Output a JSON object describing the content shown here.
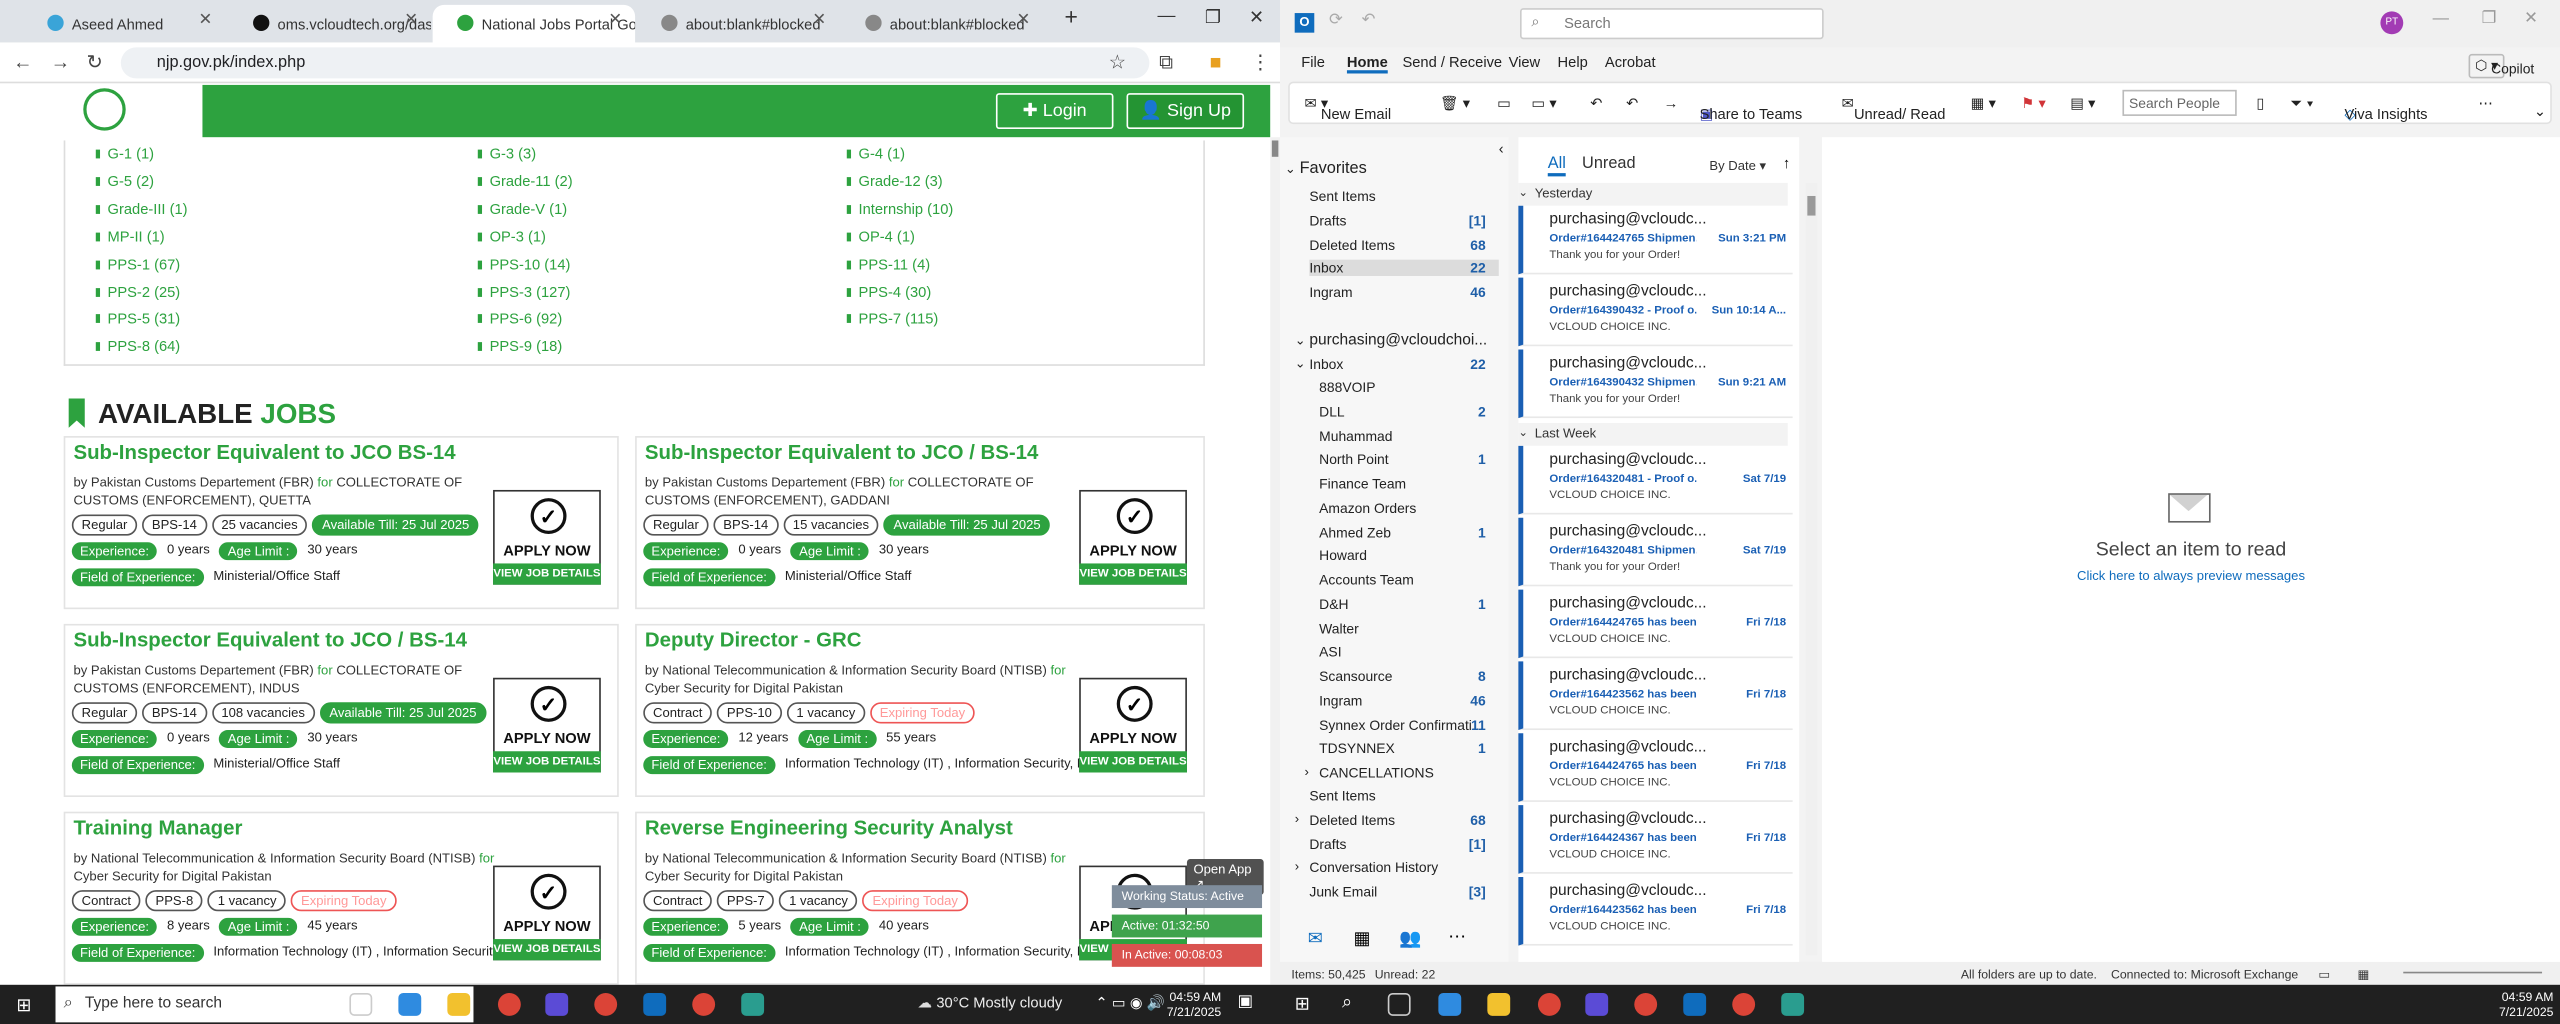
{
  "chrome": {
    "tabs": [
      {
        "label": "Aseed Ahmed"
      },
      {
        "label": "oms.vcloudtech.org/dash"
      },
      {
        "label": "National Jobs Portal Gov"
      },
      {
        "label": "about:blank#blocked"
      },
      {
        "label": "about:blank#blocked"
      }
    ],
    "address": "njp.gov.pk/index.php",
    "login": "Login",
    "signup": "Sign Up"
  },
  "grades": [
    "G-1 (1)",
    "G-3 (3)",
    "G-4 (1)",
    "G-5 (2)",
    "Grade-11 (2)",
    "Grade-12 (3)",
    "Grade-III (1)",
    "Grade-V (1)",
    "Internship (10)",
    "MP-II (1)",
    "OP-3 (1)",
    "OP-4 (1)",
    "PPS-1 (67)",
    "PPS-10 (14)",
    "PPS-11 (4)",
    "PPS-2 (25)",
    "PPS-3 (127)",
    "PPS-4 (30)",
    "PPS-5 (31)",
    "PPS-6 (92)",
    "PPS-7 (115)",
    "PPS-8 (64)",
    "PPS-9 (18)"
  ],
  "section": {
    "title_a": "AVAILABLE",
    "title_b": "JOBS"
  },
  "jobs": [
    {
      "title": "Sub-Inspector Equivalent to JCO BS-14",
      "by": "by",
      "org": "Pakistan Customs Departement (FBR)",
      "for": "for",
      "dept": "COLLECTORATE OF CUSTOMS (ENFORCEMENT), QUETTA",
      "type": "Regular",
      "grade": "BPS-14",
      "vac": "25 vacancies",
      "till": "Available Till: 25 Jul 2025",
      "exp_l": "Experience:",
      "exp": "0 years",
      "age_l": "Age Limit :",
      "age": "30 years",
      "foe_l": "Field of Experience:",
      "foe": "Ministerial/Office Staff",
      "apply": "APPLY NOW",
      "details": "VIEW JOB DETAILS"
    },
    {
      "title": "Sub-Inspector Equivalent to JCO / BS-14",
      "by": "by",
      "org": "Pakistan Customs Departement (FBR)",
      "for": "for",
      "dept": "COLLECTORATE OF CUSTOMS (ENFORCEMENT), GADDANI",
      "type": "Regular",
      "grade": "BPS-14",
      "vac": "15 vacancies",
      "till": "Available Till: 25 Jul 2025",
      "exp_l": "Experience:",
      "exp": "0 years",
      "age_l": "Age Limit :",
      "age": "30 years",
      "foe_l": "Field of Experience:",
      "foe": "Ministerial/Office Staff",
      "apply": "APPLY NOW",
      "details": "VIEW JOB DETAILS"
    },
    {
      "title": "Sub-Inspector Equivalent to JCO / BS-14",
      "by": "by",
      "org": "Pakistan Customs Departement (FBR)",
      "for": "for",
      "dept": "COLLECTORATE OF CUSTOMS (ENFORCEMENT), INDUS",
      "type": "Regular",
      "grade": "BPS-14",
      "vac": "108 vacancies",
      "till": "Available Till: 25 Jul 2025",
      "exp_l": "Experience:",
      "exp": "0 years",
      "age_l": "Age Limit :",
      "age": "30 years",
      "foe_l": "Field of Experience:",
      "foe": "Ministerial/Office Staff",
      "apply": "APPLY NOW",
      "details": "VIEW JOB DETAILS"
    },
    {
      "title": "Deputy Director - GRC",
      "by": "by",
      "org": "National Telecommunication & Information Security Board (NTISB)",
      "for": "for",
      "dept": "Cyber Security for Digital Pakistan",
      "type": "Contract",
      "grade": "PPS-10",
      "vac": "1 vacancy",
      "till": "Expiring Today",
      "exp_l": "Experience:",
      "exp": "12 years",
      "age_l": "Age Limit :",
      "age": "55 years",
      "foe_l": "Field of Experience:",
      "foe": "Information Technology (IT) , Information Security, Project M",
      "apply": "APPLY NOW",
      "details": "VIEW JOB DETAILS"
    },
    {
      "title": "Training Manager",
      "by": "by",
      "org": "National Telecommunication & Information Security Board (NTISB)",
      "for": "for",
      "dept": "Cyber Security for Digital Pakistan",
      "type": "Contract",
      "grade": "PPS-8",
      "vac": "1 vacancy",
      "till": "Expiring Today",
      "exp_l": "Experience:",
      "exp": "8 years",
      "age_l": "Age Limit :",
      "age": "45 years",
      "foe_l": "Field of Experience:",
      "foe": "Information Technology (IT) , Information Security, Projec",
      "apply": "APPLY NOW",
      "details": "VIEW JOB DETAILS"
    },
    {
      "title": "Reverse Engineering Security Analyst",
      "by": "by",
      "org": "National Telecommunication & Information Security Board (NTISB)",
      "for": "for",
      "dept": "Cyber Security for Digital Pakistan",
      "type": "Contract",
      "grade": "PPS-7",
      "vac": "1 vacancy",
      "till": "Expiring Today",
      "exp_l": "Experience:",
      "exp": "5 years",
      "age_l": "Age Limit :",
      "age": "40 years",
      "foe_l": "Field of Experience:",
      "foe": "Information Technology (IT) , Information Security, Project M",
      "apply": "APPLY NOW",
      "details": "VIEW JOB DETAILS"
    }
  ],
  "tracker": {
    "open": "Open App ↗",
    "status": "Working Status: Active",
    "active": "Active: 01:32:50",
    "inactive": "In Active: 00:08:03"
  },
  "outlook": {
    "search": "Search",
    "copilot": "Copilot",
    "avatar": "PT",
    "menu": [
      "File",
      "Home",
      "Send / Receive",
      "View",
      "Help",
      "Acrobat"
    ],
    "ribbon": {
      "new_email": "New Email",
      "share": "Share to Teams",
      "unread": "Unread/ Read",
      "search_people": "Search People",
      "viva": "Viva Insights"
    },
    "favorites_label": "Favorites",
    "favorites": [
      {
        "name": "Sent Items",
        "count": ""
      },
      {
        "name": "Drafts",
        "count": "[1]"
      },
      {
        "name": "Deleted Items",
        "count": "68"
      },
      {
        "name": "Inbox",
        "count": "22"
      },
      {
        "name": "Ingram",
        "count": "46"
      }
    ],
    "account": "purchasing@vcloudchoi...",
    "inbox_label": "Inbox",
    "inbox_count": "22",
    "subfolders": [
      {
        "name": "888VOIP",
        "count": ""
      },
      {
        "name": "DLL",
        "count": "2"
      },
      {
        "name": "Muhammad",
        "count": ""
      },
      {
        "name": "North Point",
        "count": "1"
      },
      {
        "name": "Finance Team",
        "count": ""
      },
      {
        "name": "Amazon Orders",
        "count": ""
      },
      {
        "name": "Ahmed Zeb",
        "count": "1"
      },
      {
        "name": "Howard",
        "count": ""
      },
      {
        "name": "Accounts Team",
        "count": ""
      },
      {
        "name": "D&H",
        "count": "1"
      },
      {
        "name": "Walter",
        "count": ""
      },
      {
        "name": "ASI",
        "count": ""
      },
      {
        "name": "Scansource",
        "count": "8"
      },
      {
        "name": "Ingram",
        "count": "46"
      },
      {
        "name": "Synnex Order Confirmati...",
        "count": "11"
      },
      {
        "name": "TDSYNNEX",
        "count": "1"
      },
      {
        "name": "CANCELLATIONS",
        "count": ""
      }
    ],
    "root_folders": [
      {
        "name": "Sent Items",
        "count": ""
      },
      {
        "name": "Deleted Items",
        "count": "68"
      },
      {
        "name": "Drafts",
        "count": "[1]"
      },
      {
        "name": "Conversation History",
        "count": ""
      },
      {
        "name": "Junk Email",
        "count": "[3]"
      }
    ],
    "filter": {
      "all": "All",
      "unread": "Unread",
      "sort": "By Date"
    },
    "groups": [
      "Yesterday",
      "Last Week"
    ],
    "messages": [
      {
        "sender": "purchasing@vcloudc...",
        "subject": "Order#164424765 Shipmen...",
        "date": "Sun 3:21 PM",
        "preview": "Thank you for your Order!"
      },
      {
        "sender": "purchasing@vcloudc...",
        "subject": "Order#164390432 - Proof o...",
        "date": "Sun 10:14 A...",
        "preview": "VCLOUD CHOICE INC."
      },
      {
        "sender": "purchasing@vcloudc...",
        "subject": "Order#164390432 Shipmen...",
        "date": "Sun 9:21 AM",
        "preview": "Thank you for your Order!"
      },
      {
        "sender": "purchasing@vcloudc...",
        "subject": "Order#164320481 - Proof o...",
        "date": "Sat 7/19",
        "preview": "VCLOUD CHOICE INC."
      },
      {
        "sender": "purchasing@vcloudc...",
        "subject": "Order#164320481 Shipmen...",
        "date": "Sat 7/19",
        "preview": "Thank you for your Order!"
      },
      {
        "sender": "purchasing@vcloudc...",
        "subject": "Order#164424765 has been...",
        "date": "Fri 7/18",
        "preview": "VCLOUD CHOICE INC."
      },
      {
        "sender": "purchasing@vcloudc...",
        "subject": "Order#164423562 has been...",
        "date": "Fri 7/18",
        "preview": "VCLOUD CHOICE INC."
      },
      {
        "sender": "purchasing@vcloudc...",
        "subject": "Order#164424765 has been...",
        "date": "Fri 7/18",
        "preview": "VCLOUD CHOICE INC."
      },
      {
        "sender": "purchasing@vcloudc...",
        "subject": "Order#164424367 has been...",
        "date": "Fri 7/18",
        "preview": "VCLOUD CHOICE INC."
      },
      {
        "sender": "purchasing@vcloudc...",
        "subject": "Order#164423562 has been...",
        "date": "Fri 7/18",
        "preview": "VCLOUD CHOICE INC."
      }
    ],
    "reading": {
      "title": "Select an item to read",
      "link": "Click here to always preview messages"
    },
    "status": {
      "items": "Items: 50,425",
      "unread": "Unread: 22",
      "sync": "All folders are up to date.",
      "conn": "Connected to: Microsoft Exchange"
    }
  },
  "taskbar": {
    "search": "Type here to search",
    "weather": "30°C  Mostly cloudy",
    "time_left": "04:59 AM",
    "date_left": "7/21/2025",
    "time_right": "04:59 AM",
    "date_right": "7/21/2025"
  },
  "colors": {
    "green": "#2da23f",
    "outlook_blue": "#1a5fb4"
  }
}
